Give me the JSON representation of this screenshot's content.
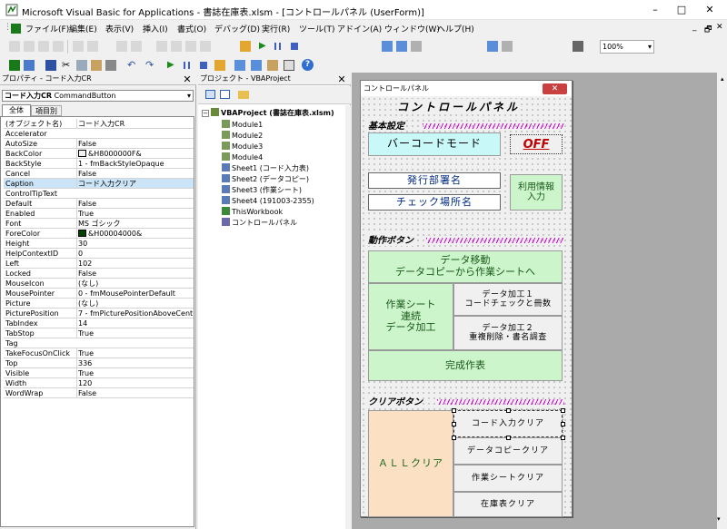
{
  "window": {
    "title": "Microsoft Visual Basic for Applications - 書誌在庫表.xlsm - [コントロールパネル (UserForm)]",
    "controls": [
      "–",
      "□",
      "✕"
    ]
  },
  "menu": {
    "items": [
      "ファイル(F)",
      "編集(E)",
      "表示(V)",
      "挿入(I)",
      "書式(O)",
      "デバッグ(D)",
      "実行(R)",
      "ツール(T)",
      "アドイン(A)",
      "ウィンドウ(W)",
      "ヘルプ(H)"
    ],
    "right_controls": [
      "_",
      "🗗",
      "✕"
    ]
  },
  "toolbar": {
    "zoom": "100%"
  },
  "properties": {
    "title": "プロパティ - コード入力CR",
    "object_name": "コード入力CR",
    "object_type": "CommandButton",
    "tabs": [
      "全体",
      "項目別"
    ],
    "rows": [
      {
        "name": "(オブジェクト名)",
        "value": "コード入力CR"
      },
      {
        "name": "Accelerator",
        "value": ""
      },
      {
        "name": "AutoSize",
        "value": "False"
      },
      {
        "name": "BackColor",
        "value": "&H8000000F&"
      },
      {
        "name": "BackStyle",
        "value": "1 - fmBackStyleOpaque"
      },
      {
        "name": "Cancel",
        "value": "False"
      },
      {
        "name": "Caption",
        "value": "コード入力クリア"
      },
      {
        "name": "ControlTipText",
        "value": ""
      },
      {
        "name": "Default",
        "value": "False"
      },
      {
        "name": "Enabled",
        "value": "True"
      },
      {
        "name": "Font",
        "value": "MS ゴシック"
      },
      {
        "name": "ForeColor",
        "value": "&H00004000&"
      },
      {
        "name": "Height",
        "value": "30"
      },
      {
        "name": "HelpContextID",
        "value": "0"
      },
      {
        "name": "Left",
        "value": "102"
      },
      {
        "name": "Locked",
        "value": "False"
      },
      {
        "name": "MouseIcon",
        "value": "(なし)"
      },
      {
        "name": "MousePointer",
        "value": "0 - fmMousePointerDefault"
      },
      {
        "name": "Picture",
        "value": "(なし)"
      },
      {
        "name": "PicturePosition",
        "value": "7 - fmPicturePositionAboveCenter"
      },
      {
        "name": "TabIndex",
        "value": "14"
      },
      {
        "name": "TabStop",
        "value": "True"
      },
      {
        "name": "Tag",
        "value": ""
      },
      {
        "name": "TakeFocusOnClick",
        "value": "True"
      },
      {
        "name": "Top",
        "value": "336"
      },
      {
        "name": "Visible",
        "value": "True"
      },
      {
        "name": "Width",
        "value": "120"
      },
      {
        "name": "WordWrap",
        "value": "False"
      }
    ],
    "swatch_colors": {
      "BackColor": "#f0f0f0",
      "ForeColor": "#004000"
    }
  },
  "project": {
    "title": "プロジェクト - VBAProject",
    "root": "VBAProject (書誌在庫表.xlsm)",
    "nodes": [
      "Module1",
      "Module2",
      "Module3",
      "Module4",
      "Sheet1 (コード入力表)",
      "Sheet2 (データコピー)",
      "Sheet3 (作業シート)",
      "Sheet4 (191003-2355)",
      "ThisWorkbook",
      "コントロールパネル"
    ]
  },
  "form": {
    "caption": "コントロールパネル",
    "heading": "コントロールパネル",
    "section_basic": "基本設定",
    "barcode_mode": "バーコードモード",
    "off_label": "OFF",
    "dept_name": "発行部署名",
    "check_place": "チェック場所名",
    "user_info": "利用情報\n入力",
    "section_action": "動作ボタン",
    "btn_data_move": "データ移動\nデータコピーから作業シートへ",
    "btn_sheet_link": "作業シート\n連続\nデータ加工",
    "btn_proc1": "データ加工１\nコードチェックと冊数",
    "btn_proc2": "データ加工２\n重複削除・書名調査",
    "btn_complete": "完成作表",
    "section_clear": "クリアボタン",
    "btn_all_clear": "ＡＬＬクリア",
    "btn_code_clear": "コード入力クリア",
    "btn_datacopy_clear": "データコピークリア",
    "btn_worksheet_clear": "作業シートクリア",
    "btn_stock_clear": "在庫表クリア"
  },
  "colors": {
    "accent_green": "#ccf5cc",
    "cyan": "#c8f8f8",
    "peach": "#fce0c4",
    "hatch": "#cc00cc",
    "off_red": "#c00000"
  }
}
